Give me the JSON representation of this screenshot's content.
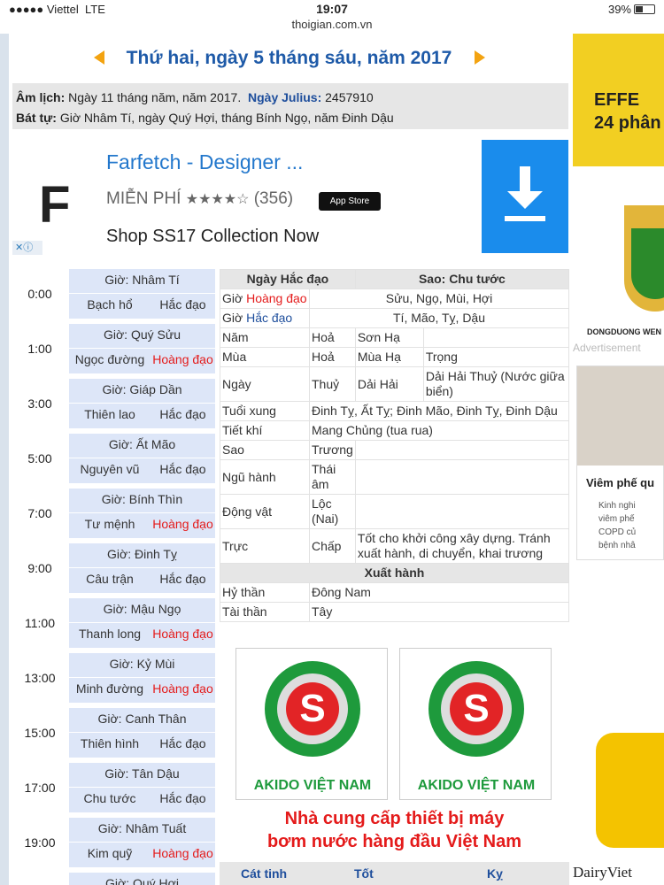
{
  "status": {
    "carrier": "●●●●● Viettel",
    "network": "LTE",
    "time": "19:07",
    "url": "thoigian.com.vn",
    "battery": "39%"
  },
  "header": {
    "date": "Thứ hai, ngày 5 tháng sáu, năm 2017"
  },
  "info": {
    "am_lich_label": "Âm lịch:",
    "am_lich": "Ngày 11 tháng năm, năm 2017.",
    "julius_label": "Ngày Julius:",
    "julius": "2457910",
    "bat_tu_label": "Bát tự:",
    "bat_tu": "Giờ Nhâm Tí, ngày Quý Hợi, tháng Bính Ngọ, năm Đinh Dậu"
  },
  "ad": {
    "name": "Farfetch - Designer ...",
    "price": "MIỄN PHÍ",
    "stars": "★★★★☆",
    "reviews": "(356)",
    "store": "App Store",
    "desc": "Shop SS17 Collection Now",
    "logo": "F",
    "close": "✕ⓘ"
  },
  "hours": [
    {
      "time": "0:00",
      "gio": "Giờ: Nhâm Tí",
      "star": "Bạch hổ",
      "dao": "Hắc đạo"
    },
    {
      "time": "1:00",
      "gio": "Giờ: Quý Sửu",
      "star": "Ngọc đường",
      "dao": "Hoàng đạo"
    },
    {
      "time": "3:00",
      "gio": "Giờ: Giáp Dần",
      "star": "Thiên lao",
      "dao": "Hắc đạo"
    },
    {
      "time": "5:00",
      "gio": "Giờ: Ất Mão",
      "star": "Nguyên vũ",
      "dao": "Hắc đạo"
    },
    {
      "time": "7:00",
      "gio": "Giờ: Bính Thìn",
      "star": "Tư mệnh",
      "dao": "Hoàng đạo"
    },
    {
      "time": "9:00",
      "gio": "Giờ: Đinh Tỵ",
      "star": "Câu trận",
      "dao": "Hắc đạo"
    },
    {
      "time": "11:00",
      "gio": "Giờ: Mậu Ngọ",
      "star": "Thanh long",
      "dao": "Hoàng đạo"
    },
    {
      "time": "13:00",
      "gio": "Giờ: Kỷ Mùi",
      "star": "Minh đường",
      "dao": "Hoàng đạo"
    },
    {
      "time": "15:00",
      "gio": "Giờ: Canh Thân",
      "star": "Thiên hình",
      "dao": "Hắc đạo"
    },
    {
      "time": "17:00",
      "gio": "Giờ: Tân Dậu",
      "star": "Chu tước",
      "dao": "Hắc đạo"
    },
    {
      "time": "19:00",
      "gio": "Giờ: Nhâm Tuất",
      "star": "Kim quỹ",
      "dao": "Hoàng đạo"
    },
    {
      "time": "",
      "gio": "Giờ: Quý Hợi",
      "star": "",
      "dao": ""
    }
  ],
  "table": {
    "ngay_hac_dao": "Ngày Hắc đạo",
    "sao": "Sao: Chu tước",
    "gio_label": "Giờ",
    "hoang_dao": "Hoàng đạo",
    "hoang_dao_hours": "Sửu, Ngọ, Mùi, Hợi",
    "hac_dao": "Hắc đạo",
    "hac_dao_hours": "Tí, Mão, Tỵ, Dậu",
    "nam": [
      "Năm",
      "Hoả",
      "Sơn Hạ",
      ""
    ],
    "mua": [
      "Mùa",
      "Hoả",
      "Mùa Hạ",
      "Trọng"
    ],
    "ngay": [
      "Ngày",
      "Thuỷ",
      "Dải Hải",
      "Dải Hải Thuỷ (Nước giữa biển)"
    ],
    "tuoi_xung": [
      "Tuổi xung",
      "Đinh Tỵ, Ất Tỵ; Đinh Mão, Đinh Tỵ, Đinh Dậu"
    ],
    "tiet_khi": [
      "Tiết khí",
      "Mang Chủng (tua rua)"
    ],
    "sao_row": [
      "Sao",
      "Trương"
    ],
    "ngu_hanh": [
      "Ngũ hành",
      "Thái âm"
    ],
    "dong_vat": [
      "Động vật",
      "Lộc (Nai)"
    ],
    "truc": [
      "Trực",
      "Chấp",
      "Tốt cho khởi công xây dựng. Tránh xuất hành, di chuyển, khai trương"
    ],
    "xuat_hanh": "Xuất hành",
    "hy_than": [
      "Hỷ thần",
      "Đông Nam"
    ],
    "tai_than": [
      "Tài thần",
      "Tây"
    ]
  },
  "akido": {
    "name1": "AKIDO VIỆT NAM",
    "name2": "AKIDO VIỆT NAM",
    "letter": "S",
    "slogan1": "Nhà cung cấp thiết bị máy",
    "slogan2": "bơm nước hàng đầu Việt Nam"
  },
  "bottom": {
    "c1": "Cát tinh",
    "c2": "Tốt",
    "c3": "Kỵ"
  },
  "side": {
    "ad1": "EFFE\n24 phân",
    "ad1_l1": "EFFE",
    "ad1_l2": "24 phân",
    "brand": "DONGDUONG WEN",
    "adv": "Advertisement",
    "title": "Viêm phế qu",
    "body1": "Kinh nghi",
    "body2": "viêm phế",
    "body3": "COPD củ",
    "body4": "bệnh nhâ",
    "dairy": "DairyViet"
  }
}
